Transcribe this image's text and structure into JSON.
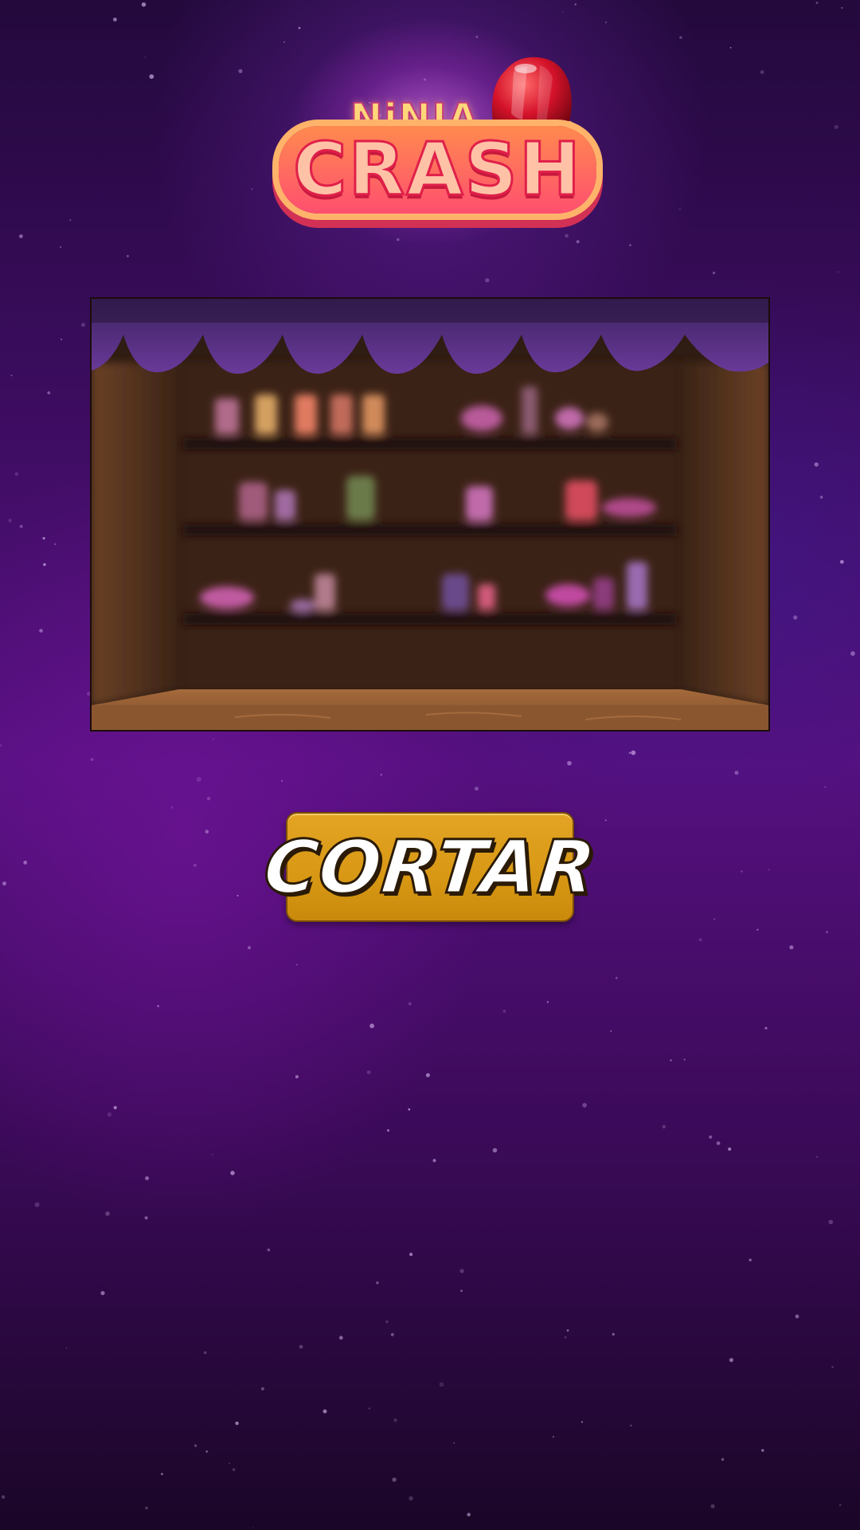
{
  "game": {
    "title_top": "NiNJA",
    "title_bottom": "CRASH"
  },
  "display": {
    "label": ""
  },
  "action": {
    "button_label": "CORTAR"
  },
  "colors": {
    "background": "#4a0d70",
    "button": "#d89814",
    "button_text": "#ffffff",
    "curtain": "#6a3a9a",
    "wood": "#3a2418"
  },
  "icons": {
    "logo_jelly": "jelly-icon"
  }
}
